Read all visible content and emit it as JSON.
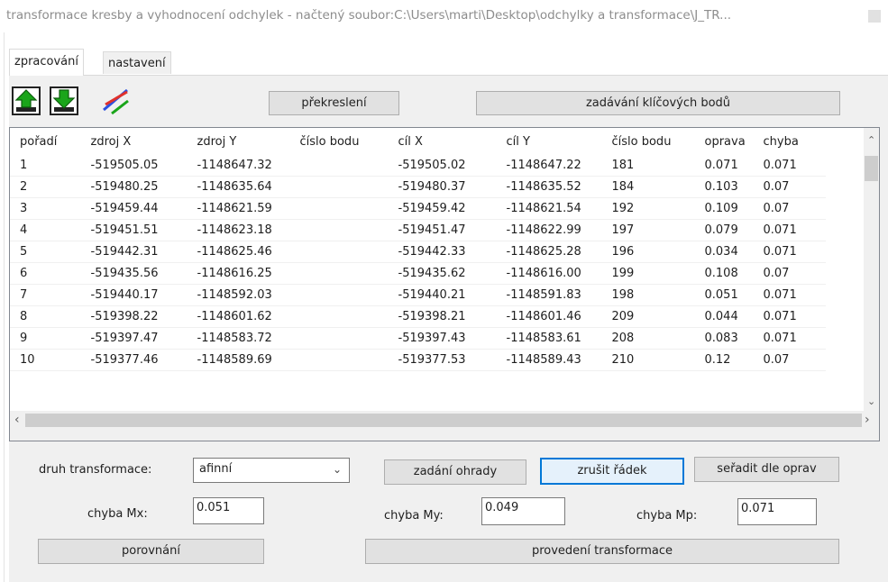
{
  "window": {
    "title": "transformace kresby a vyhodnocení odchylek - načtený soubor:C:\\Users\\marti\\Desktop\\odchylky a transformace\\J_TR..."
  },
  "tabs": [
    {
      "label": "zpracování"
    },
    {
      "label": "nastavení"
    }
  ],
  "toolbar": {
    "icons": [
      "load-icon",
      "save-icon",
      "lines-icon"
    ],
    "redraw_label": "překreslení",
    "keypoints_label": "zadávání klíčových bodů"
  },
  "table": {
    "columns": [
      "pořadí",
      "zdroj X",
      "zdroj Y",
      "číslo bodu",
      "cíl X",
      "cíl Y",
      "číslo bodu",
      "oprava",
      "chyba"
    ],
    "rows": [
      [
        "1",
        "-519505.05",
        "-1148647.32",
        "",
        "-519505.02",
        "-1148647.22",
        "181",
        "0.071",
        "0.071"
      ],
      [
        "2",
        "-519480.25",
        "-1148635.64",
        "",
        "-519480.37",
        "-1148635.52",
        "184",
        "0.103",
        "0.07"
      ],
      [
        "3",
        "-519459.44",
        "-1148621.59",
        "",
        "-519459.42",
        "-1148621.54",
        "192",
        "0.109",
        "0.07"
      ],
      [
        "4",
        "-519451.51",
        "-1148623.18",
        "",
        "-519451.47",
        "-1148622.99",
        "197",
        "0.079",
        "0.071"
      ],
      [
        "5",
        "-519442.31",
        "-1148625.46",
        "",
        "-519442.33",
        "-1148625.28",
        "196",
        "0.034",
        "0.071"
      ],
      [
        "6",
        "-519435.56",
        "-1148616.25",
        "",
        "-519435.62",
        "-1148616.00",
        "199",
        "0.108",
        "0.07"
      ],
      [
        "7",
        "-519440.17",
        "-1148592.03",
        "",
        "-519440.21",
        "-1148591.83",
        "198",
        "0.051",
        "0.071"
      ],
      [
        "8",
        "-519398.22",
        "-1148601.62",
        "",
        "-519398.21",
        "-1148601.46",
        "209",
        "0.044",
        "0.071"
      ],
      [
        "9",
        "-519397.47",
        "-1148583.72",
        "",
        "-519397.43",
        "-1148583.61",
        "208",
        "0.083",
        "0.071"
      ],
      [
        "10",
        "-519377.46",
        "-1148589.69",
        "",
        "-519377.53",
        "-1148589.43",
        "210",
        "0.12",
        "0.07"
      ]
    ]
  },
  "controls": {
    "transform_type_label": "druh transformace:",
    "transform_type_value": "afinní",
    "boundary_label": "zadání ohrady",
    "delete_row_label": "zrušit řádek",
    "sort_label": "seřadit dle oprav",
    "mx_label": "chyba Mx:",
    "mx_value": "0.051",
    "my_label": "chyba My:",
    "my_value": "0.049",
    "mp_label": "chyba Mp:",
    "mp_value": "0.071",
    "compare_label": "porovnání",
    "run_label": "provedení transformace"
  },
  "colors": {
    "accent": "#0078d7",
    "icon_green": "#1aa51a",
    "icon_red": "#e0312b",
    "icon_blue": "#2b4fe0"
  }
}
